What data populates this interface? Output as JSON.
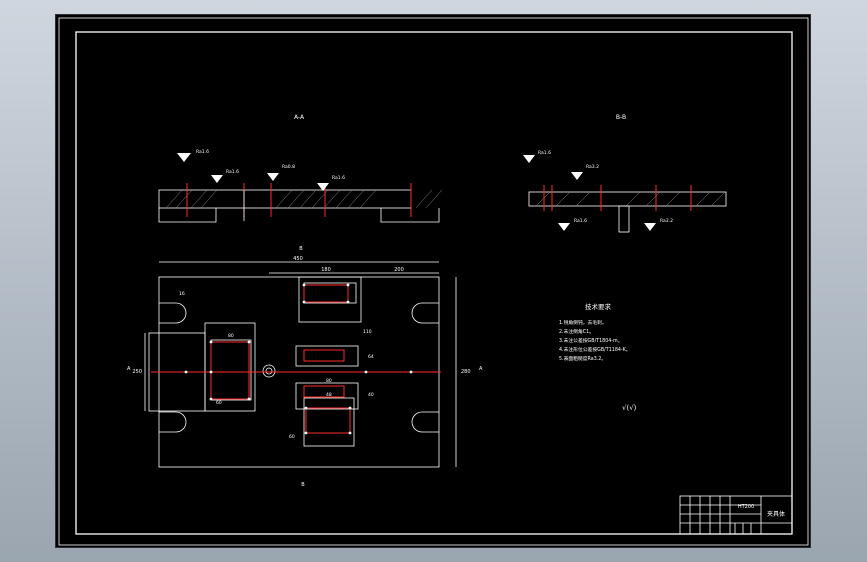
{
  "drawing": {
    "section_labels": {
      "left": "A-A",
      "right": "B-B"
    },
    "weld_marks": [
      "Ra1.6",
      "Ra1.6",
      "Ra0.8",
      "Ra1.6",
      "Ra1.6",
      "Ra3.2",
      "Ra1.6",
      "Ra3.2"
    ],
    "plan_view": {
      "top_dims": [
        "450",
        "180",
        "200"
      ],
      "side_dims": {
        "left": "250",
        "right": "280"
      },
      "cut_markers": {
        "left": "A",
        "right": "A",
        "top": "B",
        "bottom": "B"
      },
      "hole_dims": [
        "16",
        "80",
        "60",
        "110",
        "64",
        "80",
        "40",
        "48",
        "60"
      ]
    },
    "tech_requirements": {
      "title": "技术要求",
      "items": [
        "1.锐角倒钝，去毛刺。",
        "2.未注倒角C1。",
        "3.未注公差按GB/T1804-m。",
        "4.未注形位公差按GB/T1184-K。",
        "5.表面粗糙度Ra3.2。"
      ]
    },
    "roughness_note": "√(√)",
    "title_block": {
      "drawing_name": "夹具体",
      "material": "HT200"
    }
  },
  "colors": {
    "background": "#000000",
    "lines": "#ffffff",
    "centerlines": "#ff2a2a",
    "app_bg": "#a9b3bd"
  }
}
